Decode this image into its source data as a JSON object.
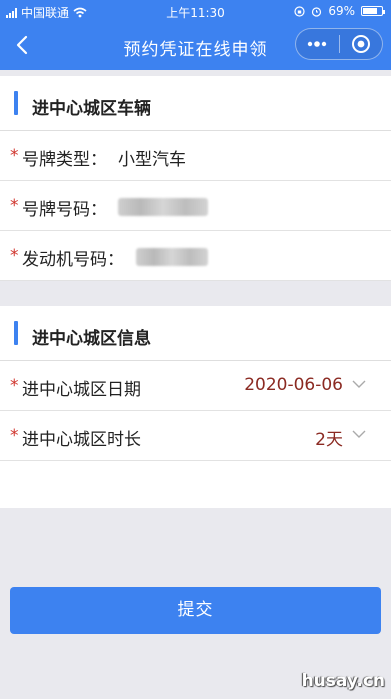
{
  "status_bar": {
    "carrier": "中国联通",
    "time": "上午11:30",
    "battery": "69%"
  },
  "nav": {
    "title": "预约凭证在线申领",
    "icons": [
      "back-icon",
      "more-icon",
      "close-target-icon"
    ]
  },
  "vehicle_section": {
    "title": "进中心城区车辆",
    "rows": [
      {
        "required": "*",
        "label": "号牌类型：",
        "value": "小型汽车"
      },
      {
        "required": "*",
        "label": "号牌号码：",
        "value": ""
      },
      {
        "required": "*",
        "label": "发动机号码：",
        "value": ""
      }
    ]
  },
  "info_section": {
    "title": "进中心城区信息",
    "rows": [
      {
        "required": "*",
        "label": "进中心城区日期",
        "value": "2020-06-06"
      },
      {
        "required": "*",
        "label": "进中心城区时长",
        "value": "2天"
      }
    ]
  },
  "submit_label": "提交",
  "watermark": "husay.cn",
  "colors": {
    "accent": "#3d82f0",
    "required": "#d0342c",
    "value": "#8b2a22",
    "background": "#e9e9ee"
  }
}
